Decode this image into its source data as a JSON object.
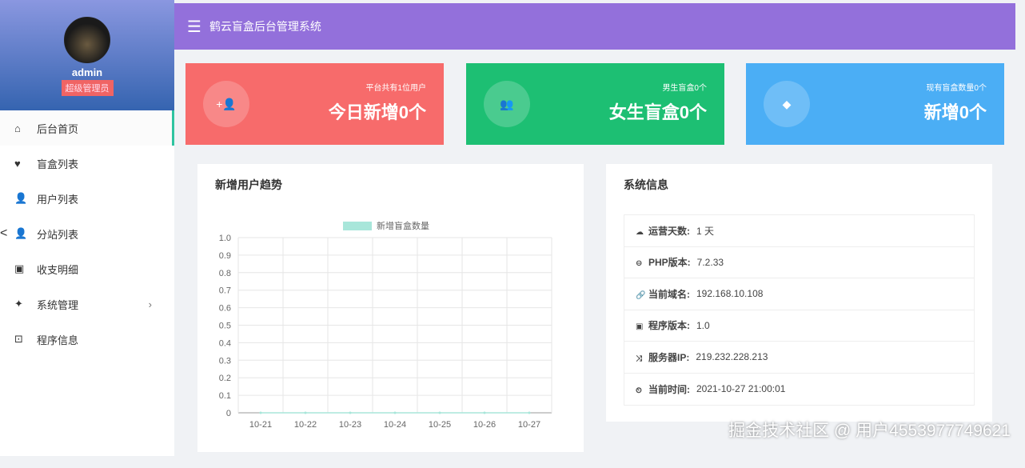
{
  "sidebar": {
    "username": "admin",
    "role": "超级管理员",
    "items": [
      {
        "label": "后台首页",
        "icon": "home-icon",
        "glyph": "⌂"
      },
      {
        "label": "盲盒列表",
        "icon": "heart-icon",
        "glyph": "♥"
      },
      {
        "label": "用户列表",
        "icon": "user-icon",
        "glyph": "👤"
      },
      {
        "label": "分站列表",
        "icon": "user-icon",
        "glyph": "👤"
      },
      {
        "label": "收支明细",
        "icon": "contact-book-icon",
        "glyph": "▣"
      },
      {
        "label": "系统管理",
        "icon": "sparkle-icon",
        "glyph": "✦"
      },
      {
        "label": "程序信息",
        "icon": "terminal-icon",
        "glyph": "⊡"
      }
    ]
  },
  "header": {
    "title": "鹤云盲盒后台管理系统"
  },
  "cards": [
    {
      "sub": "平台共有1位用户",
      "big": "今日新增0个",
      "color": "#f76b6b",
      "icon": "user-plus-icon",
      "glyph": "+👤"
    },
    {
      "sub": "男生盲盒0个",
      "big": "女生盲盒0个",
      "color": "#1dbf73",
      "icon": "users-icon",
      "glyph": "👥"
    },
    {
      "sub": "现有盲盒数量0个",
      "big": "新增0个",
      "color": "#4baef5",
      "icon": "diamond-icon",
      "glyph": "◆"
    }
  ],
  "chart_panel": {
    "title": "新增用户趋势"
  },
  "chart_data": {
    "type": "line",
    "title": "",
    "legend": [
      "新增盲盒数量"
    ],
    "legend_color": "#a8e6da",
    "categories": [
      "10-21",
      "10-22",
      "10-23",
      "10-24",
      "10-25",
      "10-26",
      "10-27"
    ],
    "series": [
      {
        "name": "新增盲盒数量",
        "values": [
          0,
          0,
          0,
          0,
          0,
          0,
          0
        ]
      }
    ],
    "ylim": [
      0,
      1
    ],
    "yticks": [
      "0",
      "0.1",
      "0.2",
      "0.3",
      "0.4",
      "0.5",
      "0.6",
      "0.7",
      "0.8",
      "0.9",
      "1.0"
    ],
    "grid": true,
    "legend_position": "top-center"
  },
  "sysinfo": {
    "title": "系统信息",
    "rows": [
      {
        "icon": "cloud-icon",
        "glyph": "☁",
        "key": "运营天数:",
        "value": "1 天"
      },
      {
        "icon": "php-icon",
        "glyph": "⊖",
        "key": "PHP版本:",
        "value": "7.2.33"
      },
      {
        "icon": "link-icon",
        "glyph": "🔗",
        "key": "当前域名:",
        "value": "192.168.10.108"
      },
      {
        "icon": "android-icon",
        "glyph": "▣",
        "key": "程序版本:",
        "value": "1.0"
      },
      {
        "icon": "shuffle-icon",
        "glyph": "⤨",
        "key": "服务器IP:",
        "value": "219.232.228.213"
      },
      {
        "icon": "clock-icon",
        "glyph": "⏲",
        "key": "当前时间:",
        "value": "2021-10-27 21:00:01"
      }
    ]
  },
  "watermark": "掘金技术社区 @ 用户4553977749621"
}
